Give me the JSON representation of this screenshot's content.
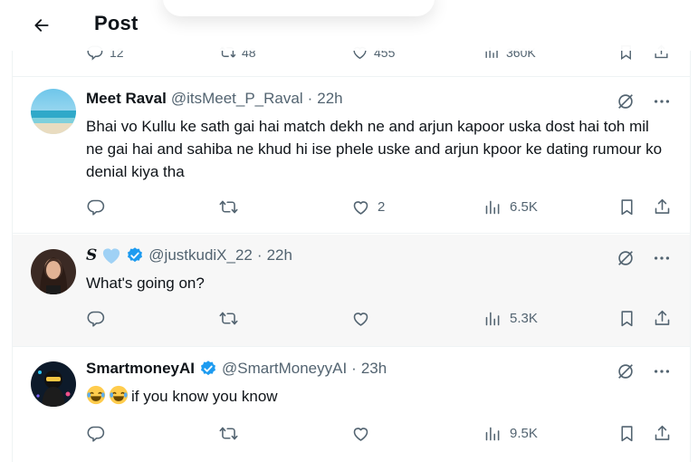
{
  "header": {
    "title": "Post"
  },
  "prev_actions": {
    "replies": "12",
    "reposts": "48",
    "likes": "455",
    "views": "360K"
  },
  "tweets": [
    {
      "name": "Meet Raval",
      "handle": "@itsMeet_P_Raval",
      "dot": "·",
      "time": "22h",
      "text": "Bhai vo Kullu ke sath gai hai match dekh ne and arjun kapoor uska dost hai toh mil ne gai hai and sahiba ne khud hi ise phele uske and arjun kpoor ke dating rumour ko denial kiya tha",
      "replies": "",
      "reposts": "",
      "likes": "2",
      "views": "6.5K"
    },
    {
      "name": "S",
      "handle": "@justkudiX_22",
      "dot": "·",
      "time": "22h",
      "text": "What's going on?",
      "replies": "",
      "reposts": "",
      "likes": "",
      "views": "5.3K"
    },
    {
      "name": "SmartmoneyAI",
      "handle": "@SmartMoneyyAI",
      "dot": "·",
      "time": "23h",
      "text": "if you know you know",
      "replies": "",
      "reposts": "",
      "likes": "",
      "views": "9.5K"
    }
  ],
  "colors": {
    "secondary_text": "#536471",
    "verified": "#1d9bf0",
    "hover_bg": "#f7f7f7",
    "border": "#eff3f4"
  },
  "icons": [
    "back-arrow-icon",
    "grok-icon",
    "more-icon",
    "reply-icon",
    "repost-icon",
    "like-icon",
    "views-icon",
    "bookmark-icon",
    "share-icon",
    "verified-icon",
    "blue-heart-emoji",
    "laughing-emoji"
  ]
}
